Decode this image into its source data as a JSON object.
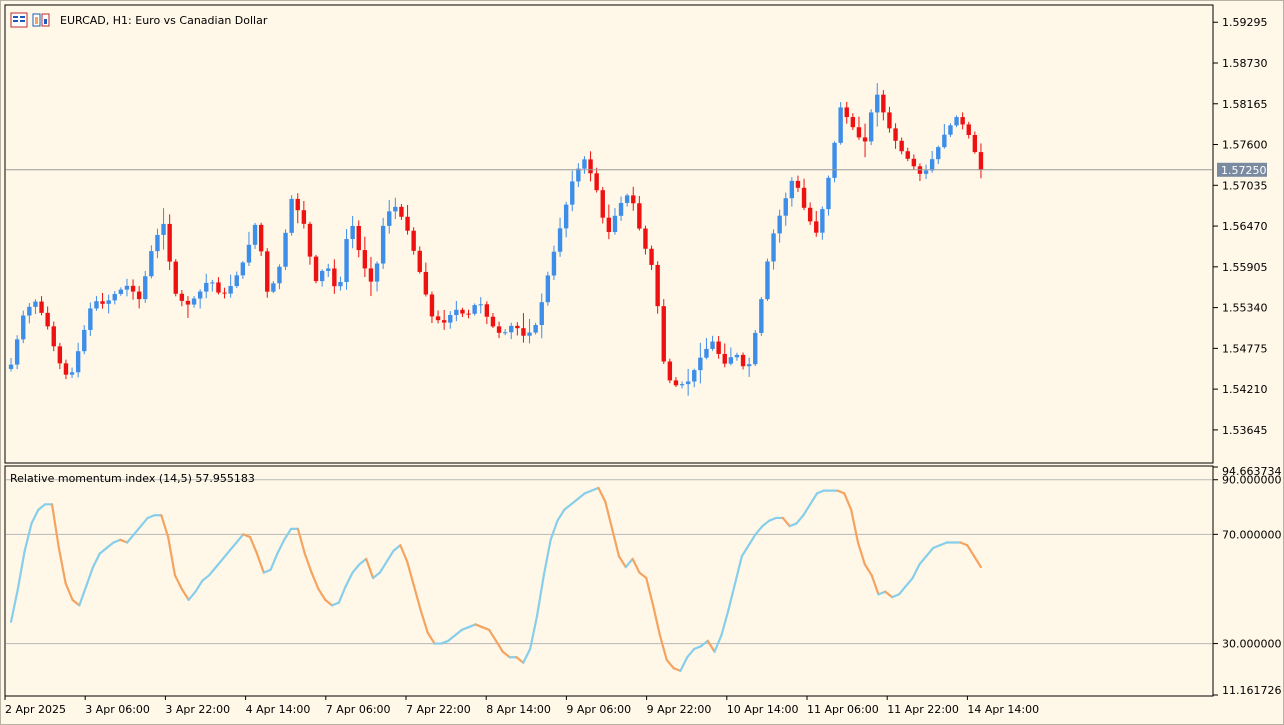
{
  "header": {
    "symbol": "EURCAD",
    "timeframe": "H1",
    "title": "EURCAD, H1:  Euro vs Canadian Dollar"
  },
  "colors": {
    "background": "#fff7e8",
    "bull": "#3d8ee8",
    "bear": "#ee1111",
    "rmi_up": "#87ceeb",
    "rmi_down": "#f4a460",
    "level": "#b8b8b8",
    "price_line": "#9a9a9a",
    "price_tag_bg": "#7a8aa0"
  },
  "chart_data": [
    {
      "type": "candlestick",
      "title": "EURCAD, H1:  Euro vs Canadian Dollar",
      "ylim": [
        1.532,
        1.5952
      ],
      "y_ticks": [
        "1.59295",
        "1.58730",
        "1.58165",
        "1.57600",
        "1.57035",
        "1.56470",
        "1.55905",
        "1.55340",
        "1.54775",
        "1.54210",
        "1.53645"
      ],
      "current_price": "1.57250",
      "last_close": 1.5725,
      "x_ticks": [
        "2 Apr 2025",
        "3 Apr 06:00",
        "3 Apr 22:00",
        "4 Apr 14:00",
        "7 Apr 06:00",
        "7 Apr 22:00",
        "8 Apr 14:00",
        "9 Apr 06:00",
        "9 Apr 22:00",
        "10 Apr 14:00",
        "11 Apr 06:00",
        "11 Apr 22:00",
        "14 Apr 14:00"
      ],
      "bars": 160,
      "path_close": [
        1.5455,
        1.5522,
        1.5545,
        1.5515,
        1.5462,
        1.5432,
        1.5488,
        1.5545,
        1.5538,
        1.5555,
        1.5565,
        1.5545,
        1.5612,
        1.5655,
        1.5555,
        1.5536,
        1.5552,
        1.5575,
        1.5548,
        1.5568,
        1.5602,
        1.5655,
        1.5548,
        1.5592,
        1.5685,
        1.5655,
        1.5568,
        1.5595,
        1.5548,
        1.5662,
        1.5598,
        1.5563,
        1.5663,
        1.5675,
        1.5638,
        1.5582,
        1.5522,
        1.5512,
        1.5532,
        1.5522,
        1.5545,
        1.5512,
        1.5495,
        1.5512,
        1.5492,
        1.5512,
        1.5583,
        1.5645,
        1.5708,
        1.5742,
        1.5705,
        1.5632,
        1.5675,
        1.5695,
        1.5628,
        1.5585,
        1.5438,
        1.5425,
        1.5432,
        1.5465,
        1.5488,
        1.5455,
        1.5472,
        1.5442,
        1.5525,
        1.5625,
        1.5672,
        1.5718,
        1.5665,
        1.5635,
        1.5718,
        1.5812,
        1.5785,
        1.5758,
        1.5835,
        1.5788,
        1.5755,
        1.5735,
        1.5715,
        1.5745,
        1.5778,
        1.58,
        1.5772,
        1.5725
      ]
    },
    {
      "type": "line",
      "title": "Relative momentum index (14,5) 57.955183",
      "series": [
        {
          "name": "Relative momentum index (14,5)",
          "last_value": 57.955183
        }
      ],
      "ylim": [
        11.161726,
        94.663734
      ],
      "y_ticks": [
        "94.663734",
        "90.000000",
        "70.000000",
        "30.000000",
        "11.161726"
      ],
      "levels": [
        90,
        70,
        30
      ],
      "values": [
        38,
        50,
        64,
        74,
        79,
        81,
        81,
        65,
        52,
        46,
        44,
        51,
        58,
        63,
        65,
        67,
        68,
        67,
        70,
        73,
        76,
        77,
        77,
        69,
        55,
        50,
        46,
        49,
        53,
        55,
        58,
        61,
        64,
        67,
        70,
        69,
        63,
        56,
        57,
        63,
        68,
        72,
        72,
        63,
        56,
        50,
        46,
        44,
        45,
        51,
        56,
        59,
        61,
        54,
        56,
        60,
        64,
        66,
        60,
        51,
        42,
        34,
        30,
        30,
        31,
        33,
        35,
        36,
        37,
        36,
        35,
        31,
        27,
        25,
        25,
        23,
        28,
        40,
        55,
        68,
        75,
        79,
        81,
        83,
        85,
        86,
        87,
        82,
        72,
        62,
        58,
        61,
        56,
        54,
        44,
        33,
        24,
        21,
        20,
        25,
        28,
        29,
        31,
        27,
        33,
        42,
        52,
        62,
        66,
        70,
        73,
        75,
        76,
        76,
        73,
        74,
        77,
        81,
        85,
        86,
        86,
        86,
        85,
        79,
        67,
        59,
        55,
        48,
        49,
        47,
        48,
        51,
        54,
        59,
        62,
        65,
        66,
        67,
        67,
        67,
        66,
        62,
        58
      ]
    }
  ]
}
